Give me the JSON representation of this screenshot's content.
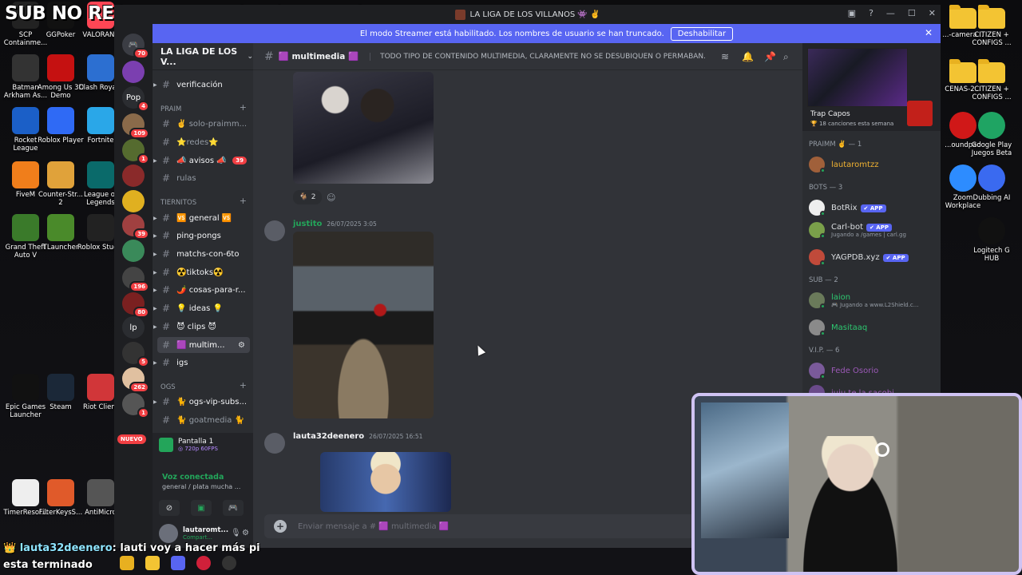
{
  "overlay": {
    "title": "SUB NO REGALADA = FOLLOW EN IG",
    "chat_user": "lauta32deenero",
    "chat_line1": ": lauti voy a hacer más pi",
    "chat_line2": "esta terminado"
  },
  "desktop_left": [
    {
      "label": "SCP Containme...",
      "color": "#222"
    },
    {
      "label": "GGPoker",
      "color": "#111"
    },
    {
      "label": "VALORANT",
      "color": "#ff4655"
    },
    {
      "label": "Batman Arkham As...",
      "color": "#333"
    },
    {
      "label": "Among Us 3D Demo",
      "color": "#c51111"
    },
    {
      "label": "Clash Royale",
      "color": "#2c6fd1"
    },
    {
      "label": "Rocket League",
      "color": "#1b5fc7"
    },
    {
      "label": "Roblox Player",
      "color": "#2f6af5"
    },
    {
      "label": "Fortnite",
      "color": "#2aa7e8"
    },
    {
      "label": "FiveM",
      "color": "#f07e1b"
    },
    {
      "label": "Counter-Str... 2",
      "color": "#e0a23a"
    },
    {
      "label": "League of Legends",
      "color": "#0a6a6a"
    },
    {
      "label": "Grand Theft Auto V",
      "color": "#3a7a2a"
    },
    {
      "label": "TLauncher",
      "color": "#4a8a2a"
    },
    {
      "label": "Roblox Studio",
      "color": "#222"
    },
    {
      "label": "Epic Games Launcher",
      "color": "#111"
    },
    {
      "label": "Steam",
      "color": "#1b2838"
    },
    {
      "label": "Riot Client",
      "color": "#d13639"
    },
    {
      "label": "TimerResol...",
      "color": "#eee"
    },
    {
      "label": "FilterKeysS...",
      "color": "#e05a2a"
    },
    {
      "label": "AntiMicro",
      "color": "#555"
    }
  ],
  "desktop_right": [
    {
      "label": "...-camera...",
      "kind": "folder"
    },
    {
      "label": "CITIZEN + CONFIGS ...",
      "kind": "folder"
    },
    {
      "label": "CENAS-2...",
      "kind": "folder"
    },
    {
      "label": "CITIZEN + CONFIGS ...",
      "kind": "folder"
    },
    {
      "label": "...oundpad",
      "kind": "app",
      "color": "#d01818"
    },
    {
      "label": "Google Play Juegos Beta",
      "kind": "app",
      "color": "#1fa463"
    },
    {
      "label": "Zoom Workplace",
      "kind": "app",
      "color": "#2d8cff"
    },
    {
      "label": "Dubbing AI",
      "kind": "app",
      "color": "#3a6af0"
    },
    {
      "label": "Logitech G HUB",
      "kind": "app",
      "color": "#111"
    }
  ],
  "window": {
    "title": "LA LIGA DE LOS VILLANOS 👾 ✌️",
    "streamer_notice": "El modo Streamer está habilitado. Los nombres de usuario se han truncado.",
    "streamer_button": "Deshabilitar"
  },
  "rail": {
    "badges": [
      "70",
      "4",
      "109",
      "1",
      "39",
      "196",
      "80",
      "5",
      "262",
      "1"
    ],
    "pop_label": "Pop",
    "lp_label": "lp",
    "new_label": "NUEVO"
  },
  "sidebar": {
    "server_name": "LA LIGA DE LOS V...",
    "channels": {
      "verificacion": "verificación",
      "cat_praim": "PRAIM",
      "solo_praimm": "✌️ solo-praimm...",
      "redes": "⭐redes⭐",
      "avisos": "📣 avisos 📣",
      "avisos_badge": "39",
      "rulas": "rulas",
      "cat_tiernitos": "TIERNITOS",
      "general": "🆚 general 🆚",
      "ping_pongs": "ping-pongs",
      "matchs": "matchs-con-6to",
      "tiktoks": "☢️tiktoks☢️",
      "cosas": "🌶️ cosas-para-r...",
      "ideas": "💡 ideas 💡",
      "clips": "😈 clips 😈",
      "multimedia": "🟪 multim...",
      "igs": "igs",
      "cat_ogs": "OGS",
      "ogs_vip": "🐈 ogs-vip-subs...",
      "goatmedia": "🐈 goatmedia 🐈"
    },
    "voice": {
      "screen_title": "Pantalla 1",
      "screen_detail": "◎ 720p 60FPS",
      "connected": "Voz conectada",
      "location": "general / plata mucha ..."
    },
    "user": {
      "name": "lautaromt...",
      "status": "Compart..."
    }
  },
  "chat": {
    "channel": "🟪 multimedia 🟪",
    "topic": "TODO TIPO DE CONTENIDO MULTIMEDIA, CLARAMENTE NO SE DESUBIQUEN O PERMABAN.",
    "reaction_emoji": "🐐",
    "reaction_count": "2",
    "messages": [
      {
        "author": "justito",
        "time": "26/07/2025 3:05",
        "color": "#23a55a"
      },
      {
        "author": "lauta32deenero",
        "time": "26/07/2025 16:51",
        "color": "#f2f3f5"
      }
    ],
    "composer_placeholder": "Enviar mensaje a # 🟪 multimedia 🟪"
  },
  "members": {
    "activity_title": "Trap Capos",
    "activity_sub": "🏆 18 canciones esta semana",
    "groups": [
      {
        "title": "praimm ✌️ — 1",
        "members": [
          {
            "name": "lautaromtzz",
            "color": "#f0b232",
            "sub": ""
          }
        ]
      },
      {
        "title": "BOTS — 3",
        "members": [
          {
            "name": "BotRix",
            "color": "#dbdee1",
            "sub": "",
            "tag": "✔ APP"
          },
          {
            "name": "Carl-bot",
            "color": "#dbdee1",
            "sub": "Jugando a /games | carl.gg",
            "tag": "✔ APP"
          },
          {
            "name": "YAGPDB.xyz",
            "color": "#dbdee1",
            "sub": "",
            "tag": "✔ APP"
          }
        ]
      },
      {
        "title": "SUB — 2",
        "members": [
          {
            "name": "laion",
            "color": "#2dc770",
            "sub": "🎮 Jugando a www.L2Shield.c..."
          },
          {
            "name": "Masitaaq",
            "color": "#2dc770",
            "sub": ""
          }
        ]
      },
      {
        "title": "V.I.P. — 6",
        "members": [
          {
            "name": "Fede Osorio",
            "color": "#9b59b6",
            "sub": ""
          },
          {
            "name": "juju te la sacobi",
            "color": "#9b59b6",
            "sub": ""
          }
        ]
      }
    ]
  }
}
